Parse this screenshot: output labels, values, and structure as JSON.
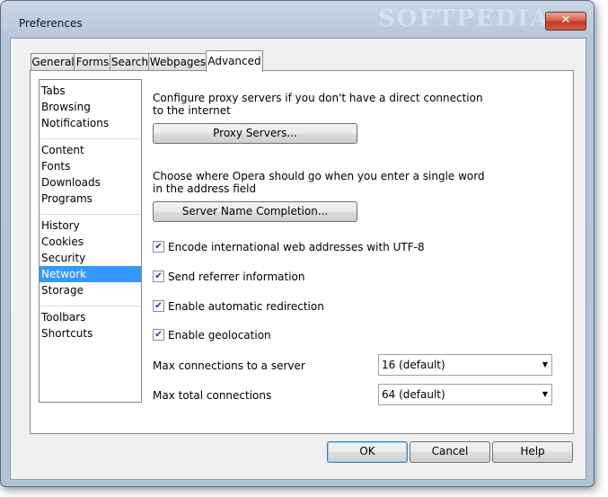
{
  "window": {
    "title": "Preferences",
    "close_label": "✕",
    "watermark": "SOFTPEDIA"
  },
  "tabs": [
    {
      "label": "General",
      "active": false
    },
    {
      "label": "Forms",
      "active": false
    },
    {
      "label": "Search",
      "active": false
    },
    {
      "label": "Webpages",
      "active": false
    },
    {
      "label": "Advanced",
      "active": true
    }
  ],
  "sidebar": {
    "groups": [
      [
        "Tabs",
        "Browsing",
        "Notifications"
      ],
      [
        "Content",
        "Fonts",
        "Downloads",
        "Programs"
      ],
      [
        "History",
        "Cookies",
        "Security",
        "Network",
        "Storage"
      ],
      [
        "Toolbars",
        "Shortcuts"
      ]
    ],
    "selected": "Network"
  },
  "network": {
    "proxy_desc": "Configure proxy servers if you don't have a direct connection to the internet",
    "proxy_button": "Proxy Servers...",
    "completion_desc": "Choose where Opera should go when you enter a single word in the address field",
    "completion_button": "Server Name Completion...",
    "checkboxes": [
      {
        "label": "Encode international web addresses with UTF-8",
        "checked": true
      },
      {
        "label": "Send referrer information",
        "checked": true
      },
      {
        "label": "Enable automatic redirection",
        "checked": true
      },
      {
        "label": "Enable geolocation",
        "checked": true
      }
    ],
    "max_server_label": "Max connections to a server",
    "max_server_value": "16 (default)",
    "max_total_label": "Max total connections",
    "max_total_value": "64 (default)"
  },
  "buttons": {
    "ok": "OK",
    "cancel": "Cancel",
    "help": "Help"
  }
}
